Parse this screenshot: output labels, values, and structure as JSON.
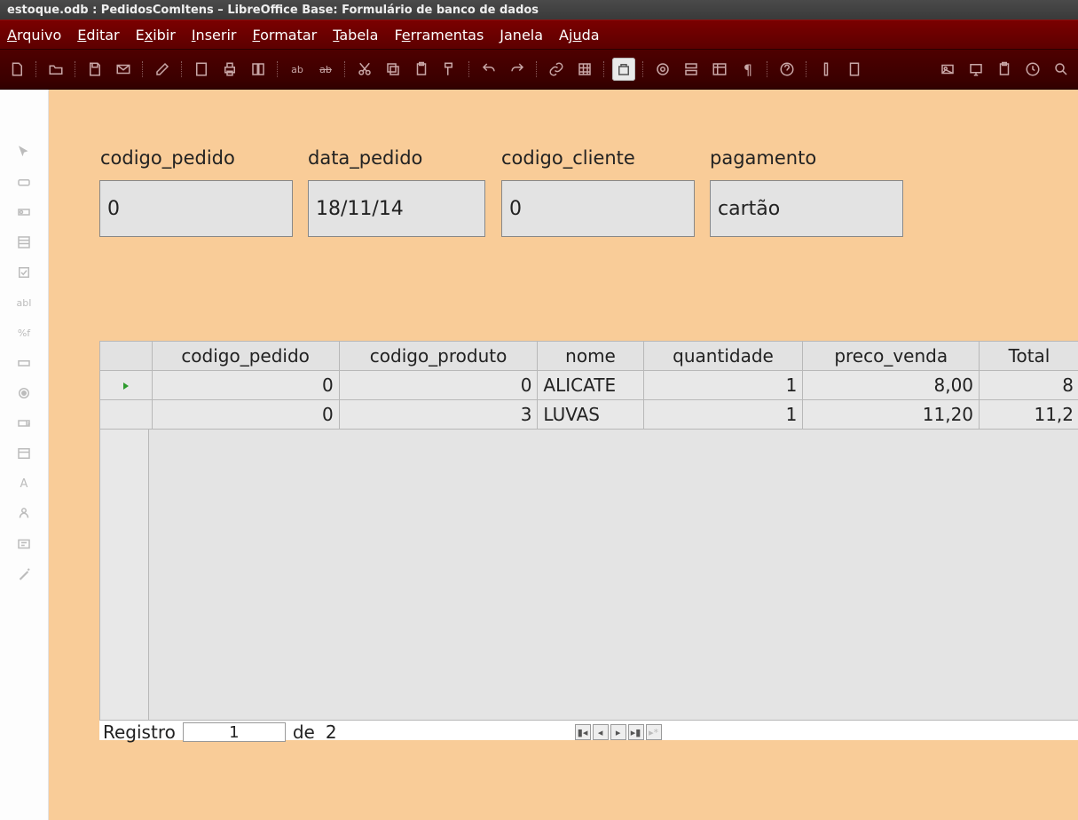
{
  "window": {
    "title": "estoque.odb : PedidosComItens – LibreOffice Base: Formulário de banco de dados"
  },
  "menu": {
    "arquivo": {
      "pre": "A",
      "rest": "rquivo"
    },
    "editar": {
      "pre": "E",
      "rest": "ditar"
    },
    "exibir": {
      "pre": "E",
      "mid": "x",
      "rest": "ibir"
    },
    "inserir": {
      "pre": "I",
      "rest": "nserir"
    },
    "formatar": {
      "pre": "F",
      "rest": "ormatar"
    },
    "tabela": {
      "pre": "T",
      "rest": "abela"
    },
    "ferramentas": {
      "pre": "F",
      "mid": "e",
      "rest": "rramentas"
    },
    "janela": {
      "pre": "J",
      "rest": "anela"
    },
    "ajuda": {
      "pre": "A",
      "mid": "j",
      "u": "u",
      "rest": "da"
    }
  },
  "form": {
    "codigo_pedido": {
      "label": "codigo_pedido",
      "value": "0"
    },
    "data_pedido": {
      "label": "data_pedido",
      "value": "18/11/14"
    },
    "codigo_cliente": {
      "label": "codigo_cliente",
      "value": "0"
    },
    "pagamento": {
      "label": "pagamento",
      "value": "cartão"
    }
  },
  "grid": {
    "headers": [
      "codigo_pedido",
      "codigo_produto",
      "nome",
      "quantidade",
      "preco_venda",
      "Total"
    ],
    "rows": [
      {
        "codigo_pedido": "0",
        "codigo_produto": "0",
        "nome": "ALICATE",
        "quantidade": "1",
        "preco_venda": "8,00",
        "total": "8"
      },
      {
        "codigo_pedido": "0",
        "codigo_produto": "3",
        "nome": "LUVAS",
        "quantidade": "1",
        "preco_venda": "11,20",
        "total": "11,2"
      }
    ]
  },
  "recnav": {
    "label": "Registro",
    "current": "1",
    "of_label": "de",
    "total": "2"
  }
}
